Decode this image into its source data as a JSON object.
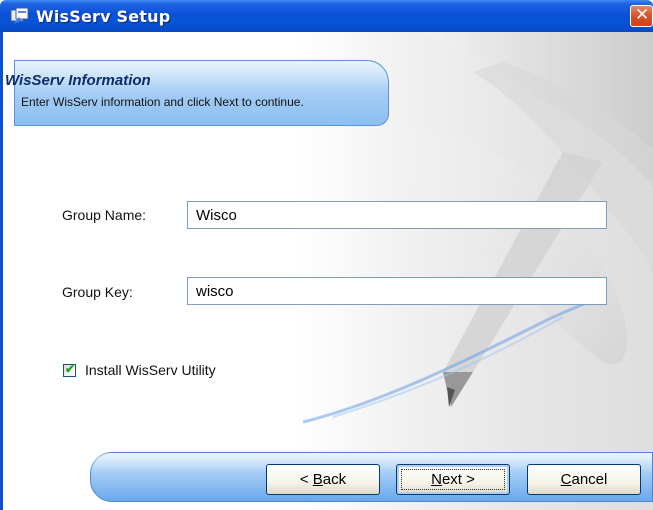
{
  "window": {
    "title": "WisServ Setup"
  },
  "header": {
    "title": "WisServ Information",
    "subtitle": "Enter WisServ information and click Next to continue."
  },
  "form": {
    "group_name_label": "Group Name:",
    "group_name_value": "Wisco",
    "group_key_label": "Group Key:",
    "group_key_value": "wisco",
    "install_utility_label": "Install WisServ Utility",
    "install_utility_checked": true
  },
  "buttons": {
    "back_prefix": "< ",
    "back_key": "B",
    "back_rest": "ack",
    "next_key": "N",
    "next_rest": "ext >",
    "cancel_key": "C",
    "cancel_rest": "ancel"
  },
  "colors": {
    "titlebar": "#0a51d8",
    "band": "#9cc8f4",
    "close": "#d9542c"
  },
  "icons": {
    "app": "setup-app-icon",
    "close": "close-icon",
    "check": "checkmark-icon"
  }
}
